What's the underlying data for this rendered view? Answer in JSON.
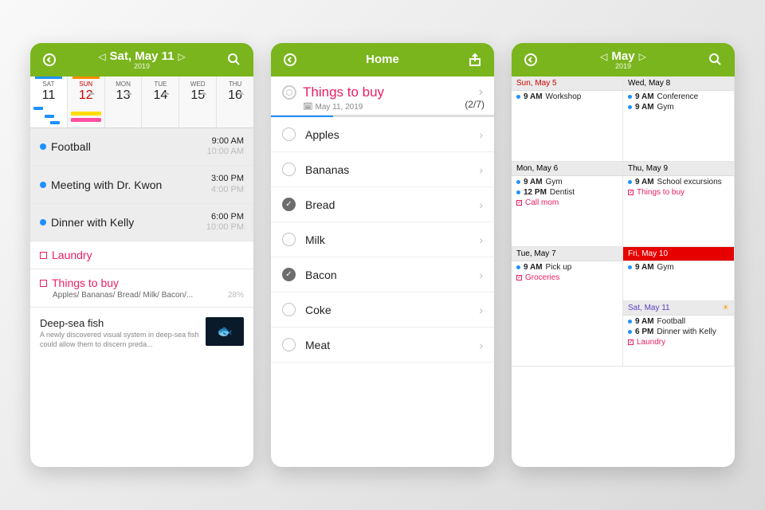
{
  "s1": {
    "title": "Sat, May 11",
    "sub": "2019",
    "days": [
      {
        "dow": "SAT",
        "num": "11",
        "cls": "selected sat"
      },
      {
        "dow": "SUN",
        "num": "12",
        "cls": "sun"
      },
      {
        "dow": "MON",
        "num": "13",
        "cls": ""
      },
      {
        "dow": "TUE",
        "num": "14",
        "cls": ""
      },
      {
        "dow": "WED",
        "num": "15",
        "cls": ""
      },
      {
        "dow": "THU",
        "num": "16",
        "cls": ""
      }
    ],
    "events": [
      {
        "title": "Football",
        "t1": "9:00 AM",
        "t2": "10:00 AM"
      },
      {
        "title": "Meeting with Dr. Kwon",
        "t1": "3:00 PM",
        "t2": "4:00 PM"
      },
      {
        "title": "Dinner with Kelly",
        "t1": "6:00 PM",
        "t2": "10:00 PM"
      }
    ],
    "tasks": [
      {
        "title": "Laundry",
        "sub": "",
        "pct": ""
      },
      {
        "title": "Things to buy",
        "sub": "Apples/ Bananas/ Bread/ Milk/ Bacon/...",
        "pct": "28%"
      }
    ],
    "news": {
      "h": "Deep-sea fish",
      "b": "A newly discovered visual system in deep-sea fish could allow them to discern preda..."
    }
  },
  "s2": {
    "title": "Home",
    "listTitle": "Things to buy",
    "listDate": "May 11, 2019",
    "counter": "(2/7)",
    "progress": 28,
    "items": [
      {
        "label": "Apples",
        "done": false
      },
      {
        "label": "Bananas",
        "done": false
      },
      {
        "label": "Bread",
        "done": true
      },
      {
        "label": "Milk",
        "done": false
      },
      {
        "label": "Bacon",
        "done": true
      },
      {
        "label": "Coke",
        "done": false
      },
      {
        "label": "Meat",
        "done": false
      }
    ]
  },
  "s3": {
    "title": "May",
    "sub": "2019",
    "cells": [
      {
        "head": "Sun, May 5",
        "cls": "sun",
        "rows": [
          {
            "type": "ev",
            "tm": "9 AM",
            "lb": "Workshop"
          }
        ]
      },
      {
        "head": "Wed, May 8",
        "cls": "",
        "rows": [
          {
            "type": "ev",
            "tm": "9 AM",
            "lb": "Conference"
          },
          {
            "type": "ev",
            "tm": "9 AM",
            "lb": "Gym"
          }
        ]
      },
      {
        "head": "Mon, May 6",
        "cls": "",
        "rows": [
          {
            "type": "ev",
            "tm": "9 AM",
            "lb": "Gym"
          },
          {
            "type": "ev",
            "tm": "12 PM",
            "lb": "Dentist"
          },
          {
            "type": "task",
            "lb": "Call mom"
          }
        ]
      },
      {
        "head": "Thu, May 9",
        "cls": "",
        "rows": [
          {
            "type": "ev",
            "tm": "9 AM",
            "lb": "School excursions"
          },
          {
            "type": "task",
            "lb": "Things to buy"
          }
        ]
      },
      {
        "head": "Tue, May 7",
        "cls": "",
        "rows": [
          {
            "type": "ev",
            "tm": "9 AM",
            "lb": "Pick up"
          },
          {
            "type": "task",
            "lb": "Groceries"
          }
        ]
      },
      {
        "head": "Fri, May 10",
        "cls": "today",
        "sat": {
          "head": "Sat, May 11",
          "cls": "sat",
          "rows": [
            {
              "type": "ev",
              "tm": "9 AM",
              "lb": "Football"
            },
            {
              "type": "ev",
              "tm": "6 PM",
              "lb": "Dinner with Kelly"
            },
            {
              "type": "task",
              "lb": "Laundry"
            }
          ]
        },
        "rows": [
          {
            "type": "ev",
            "tm": "9 AM",
            "lb": "Gym"
          }
        ]
      }
    ]
  }
}
